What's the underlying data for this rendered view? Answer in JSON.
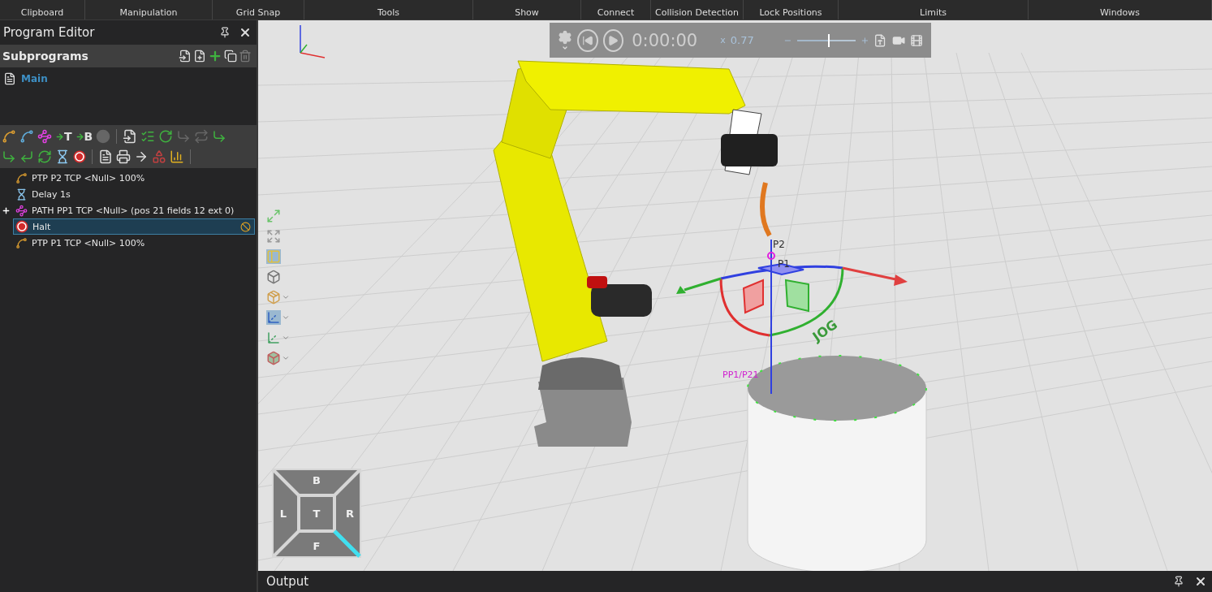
{
  "ribbon": {
    "groups": [
      "Clipboard",
      "Manipulation",
      "Grid Snap",
      "Tools",
      "Show",
      "Connect",
      "Collision Detection",
      "Lock Positions",
      "Limits",
      "Windows"
    ]
  },
  "program_editor": {
    "title": "Program Editor",
    "subprograms": {
      "title": "Subprograms",
      "items": [
        {
          "label": "Main",
          "selected": true
        }
      ]
    },
    "toolbar_letters": [
      "T",
      "B"
    ],
    "rows": [
      {
        "kind": "ptp",
        "text": "PTP P2 TCP <Null> 100%",
        "expandable": false,
        "selected": false,
        "skipped": false
      },
      {
        "kind": "delay",
        "text": "Delay 1s",
        "expandable": false,
        "selected": false,
        "skipped": false
      },
      {
        "kind": "path",
        "text": "PATH PP1 TCP <Null> (pos 21 fields 12 ext 0)",
        "expandable": true,
        "selected": false,
        "skipped": false
      },
      {
        "kind": "halt",
        "text": "Halt",
        "expandable": false,
        "selected": true,
        "skipped": true
      },
      {
        "kind": "ptp",
        "text": "PTP P1 TCP <Null> 100%",
        "expandable": false,
        "selected": false,
        "skipped": false
      }
    ]
  },
  "viewport": {
    "playback": {
      "time": "0:00:00",
      "speed_prefix": "x",
      "speed": "0.77",
      "speed_slider": {
        "level": 0.55
      }
    },
    "scene_labels": [
      {
        "kind": "point",
        "text": "P2"
      },
      {
        "kind": "point",
        "text": "P1"
      },
      {
        "kind": "path",
        "text": "PP1/P21"
      },
      {
        "kind": "jog",
        "text": "JOG"
      }
    ],
    "view_cube": {
      "top": "B",
      "left": "L",
      "center": "T",
      "right": "R",
      "bottom": "F"
    }
  },
  "output": {
    "title": "Output"
  }
}
